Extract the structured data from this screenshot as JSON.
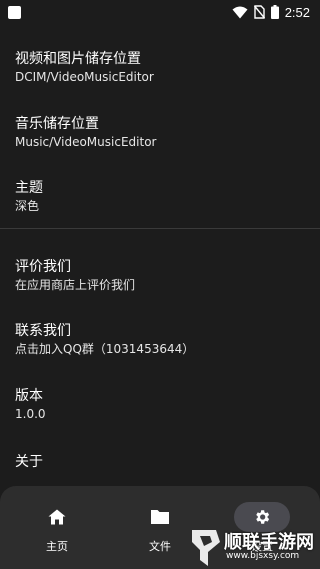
{
  "status_bar": {
    "time": "2:52",
    "icons": [
      "app-icon",
      "wifi-icon",
      "no-sim-icon",
      "battery-icon"
    ]
  },
  "settings": [
    {
      "title": "视频和图片储存位置",
      "subtitle": "DCIM/VideoMusicEditor"
    },
    {
      "title": "音乐储存位置",
      "subtitle": "Music/VideoMusicEditor"
    },
    {
      "title": "主题",
      "subtitle": "深色"
    },
    {
      "title": "评价我们",
      "subtitle": "在应用商店上评价我们"
    },
    {
      "title": "联系我们",
      "subtitle": "点击加入QQ群（1031453644）"
    },
    {
      "title": "版本",
      "subtitle": "1.0.0"
    },
    {
      "title": "关于",
      "subtitle": ""
    }
  ],
  "bottom_nav": {
    "items": [
      {
        "label": "主页",
        "icon": "home-icon",
        "active": false
      },
      {
        "label": "文件",
        "icon": "folder-icon",
        "active": false
      },
      {
        "label": "设置",
        "icon": "gear-icon",
        "active": true
      }
    ]
  },
  "watermark": {
    "text": "顺联手游网",
    "url": "www.bjsxsy.com"
  },
  "colors": {
    "background": "#1c1c1c",
    "nav_background": "#2d2d2d",
    "active_pill": "#4a4a50",
    "text": "#ffffff"
  }
}
